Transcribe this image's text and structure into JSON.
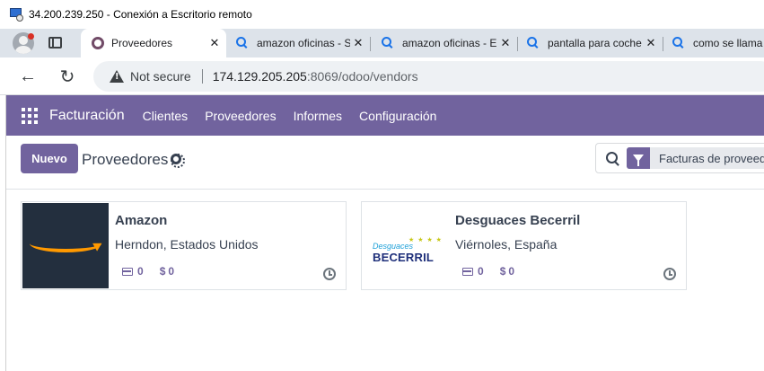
{
  "rdp": {
    "title": "34.200.239.250 - Conexión a Escritorio remoto"
  },
  "browser": {
    "tabs": [
      {
        "label": "Proveedores",
        "icon": "odoo-icon",
        "active": true
      },
      {
        "label": "amazon oficinas - S",
        "icon": "search-icon",
        "active": false
      },
      {
        "label": "amazon oficinas - E",
        "icon": "search-icon",
        "active": false
      },
      {
        "label": "pantalla para coche",
        "icon": "search-icon",
        "active": false
      },
      {
        "label": "como se llama",
        "icon": "search-icon",
        "active": false
      }
    ],
    "close_glyph": "✕",
    "security_label": "Not secure",
    "url_host": "174.129.205.205",
    "url_path": ":8069/odoo/vendors"
  },
  "odoo": {
    "app_name": "Facturación",
    "menu": [
      "Clientes",
      "Proveedores",
      "Informes",
      "Configuración"
    ],
    "new_button": "Nuevo",
    "page_title": "Proveedores",
    "search_facet": "Facturas de proveedo",
    "accent_color": "#71639e"
  },
  "vendors": [
    {
      "name": "Amazon",
      "location": "Herndon, Estados Unidos",
      "bills": "0",
      "amount_symbol": "$",
      "amount": "0"
    },
    {
      "name": "Desguaces Becerril",
      "location": "Viérnoles, España",
      "bills": "0",
      "amount_symbol": "$",
      "amount": "0",
      "logo_small": "Desguaces",
      "logo_big": "BECERRIL"
    }
  ]
}
